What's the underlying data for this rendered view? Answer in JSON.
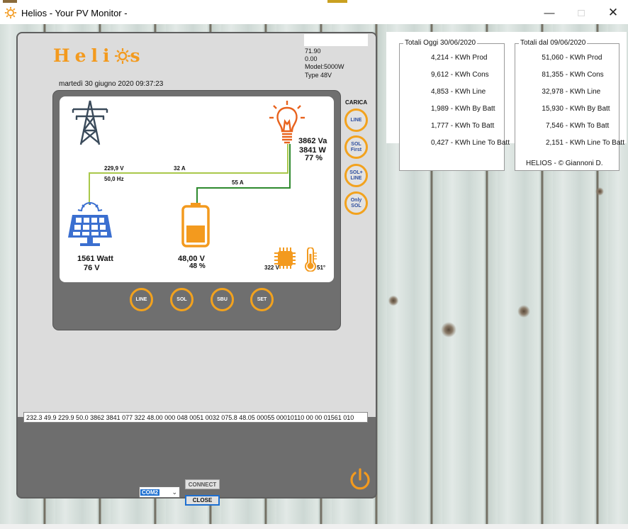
{
  "window": {
    "title": "Helios  -  Your PV Monitor  -"
  },
  "device": {
    "logo": "Helios",
    "info": [
      "71.90",
      "0.00",
      "Model:5000W",
      "Type 48V"
    ],
    "datetime": "martedì 30 giugno 2020 09:37:23",
    "grid": {
      "voltage": "229,9 V",
      "frequency": "50,0 Hz",
      "current": "32 A"
    },
    "load": {
      "va": "3862 Va",
      "watt": "3841 W",
      "percent": "77 %"
    },
    "battery": {
      "current": "55 A",
      "voltage": "48,00 V",
      "percent": "48 %",
      "fill_level": 0.48
    },
    "solar": {
      "watt": "1561 Watt",
      "voltage": "76 V"
    },
    "inverter": {
      "bus_voltage": "322 V",
      "temperature": "51°"
    },
    "charge_title": "CARICA",
    "charge_buttons": [
      "LINE",
      "SOL First",
      "SOL+ LINE",
      "Only SOL"
    ],
    "mode_buttons": [
      "LINE",
      "SOL",
      "SBU",
      "SET"
    ],
    "serial": "232.3 49.9 229.9 50.0 3862 3841 077 322 48.00 000 048 0051 0032 075.8 48.05 00055 00010110 00 00 01561 010",
    "com_port": "COM2",
    "connect_label": "CONNECT",
    "close_label": "CLOSE"
  },
  "totals_today": {
    "title": "Totali Oggi 30/06/2020",
    "rows": [
      {
        "value": "4,214",
        "label": " - KWh Prod"
      },
      {
        "value": "9,612",
        "label": " - KWh Cons"
      },
      {
        "value": "4,853",
        "label": " - KWh  Line"
      },
      {
        "value": "1,989",
        "label": " - KWh By Batt"
      },
      {
        "value": "1,777",
        "label": " - KWh To Batt"
      },
      {
        "value": "0,427",
        "label": " - KWh Line To Batt"
      }
    ]
  },
  "totals_since": {
    "title": "Totali dal 09/06/2020",
    "rows": [
      {
        "value": "51,060",
        "label": " - KWh Prod"
      },
      {
        "value": "81,355",
        "label": " - KWh Cons"
      },
      {
        "value": "32,978",
        "label": " - KWh  Line"
      },
      {
        "value": "15,930",
        "label": " - KWh By Batt"
      },
      {
        "value": "7,546",
        "label": " - KWh To Batt"
      },
      {
        "value": "2,151",
        "label": " - KWh Line To Batt"
      }
    ],
    "copyright": "HELIOS - © Giannoni D."
  },
  "colors": {
    "accent": "#f39a1e",
    "grid_line": "#a9c84a",
    "battery_line": "#2e8a2e",
    "solar_blue": "#3b6fd0"
  }
}
